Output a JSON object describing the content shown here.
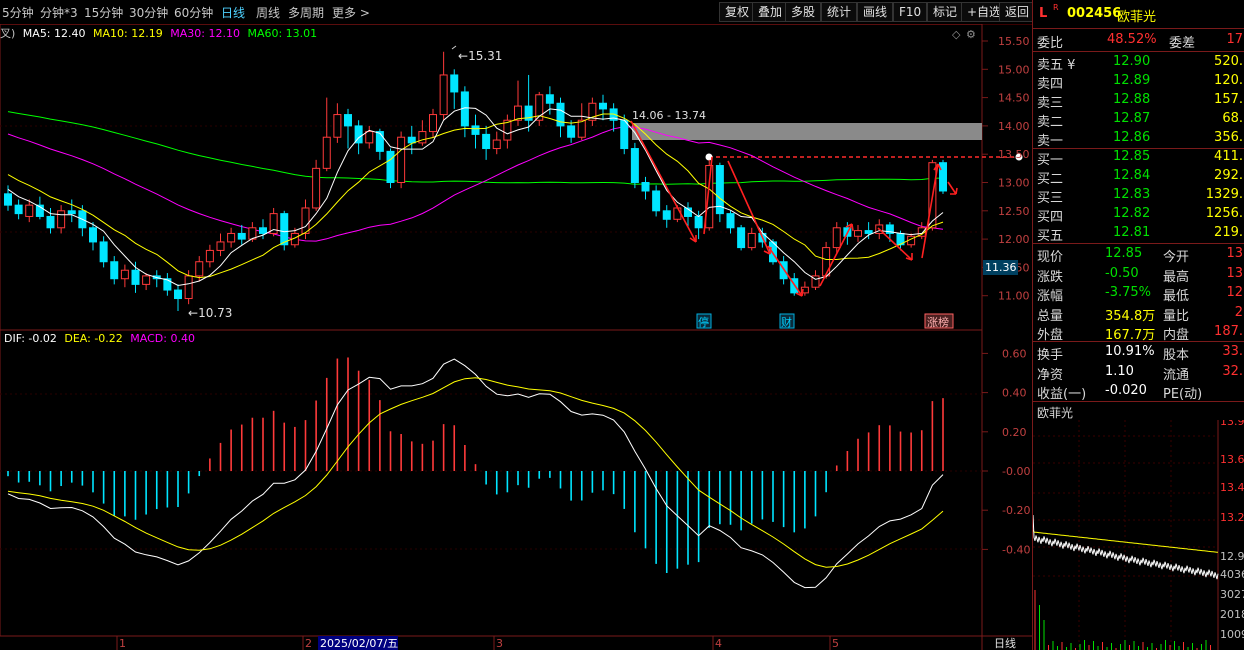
{
  "toolbar": {
    "timeframes": [
      "5分钟",
      "分钟*3",
      "15分钟",
      "30分钟",
      "60分钟",
      "日线",
      "周线",
      "多周期",
      "更多"
    ],
    "active": "日线",
    "buttons": [
      "复权",
      "叠加",
      "多股",
      "统计",
      "画线",
      "F10",
      "标记",
      "+自选",
      "返回"
    ]
  },
  "colors": {
    "up": "#ff3a3a",
    "down": "#00e5ff",
    "ma5": "#ffffff",
    "ma10": "#ffff00",
    "ma30": "#ff00ff",
    "ma60": "#00ff00",
    "accent_red": "#ff2020"
  },
  "ma_legend": {
    "prefix": "叉)",
    "ma5": "MA5: 12.40",
    "ma10": "MA10: 12.19",
    "ma30": "MA30: 12.10",
    "ma60": "MA60: 13.01"
  },
  "price_axis": [
    "15.50",
    "15.00",
    "14.50",
    "14.00",
    "13.50",
    "13.00",
    "12.50",
    "12.00",
    "11.50",
    "11.00"
  ],
  "price_marker": "11.36",
  "annotations": {
    "high": "15.31",
    "low": "10.73",
    "zone": "14.06 - 13.74",
    "badges": [
      "停",
      "财",
      "涨榜"
    ]
  },
  "macd_legend": {
    "dif": "DIF: -0.02",
    "dea": "DEA: -0.22",
    "macd": "MACD: 0.40"
  },
  "macd_axis": [
    "0.60",
    "0.40",
    "0.20",
    "-0.00",
    "-0.20",
    "-0.40"
  ],
  "date_axis": {
    "ticks": [
      "1",
      "2",
      "3",
      "4",
      "5"
    ],
    "highlight": "2025/02/07/五",
    "period": "日线"
  },
  "stock": {
    "flag": "L",
    "code": "002456",
    "name": "欧菲光"
  },
  "quote": {
    "weibi_label": "委比",
    "weibi": "48.52%",
    "weicha_label": "委差",
    "weicha": "17",
    "asks": [
      {
        "label": "卖五",
        "mark": "¥",
        "price": "12.90",
        "vol": "520."
      },
      {
        "label": "卖四",
        "mark": "",
        "price": "12.89",
        "vol": "120."
      },
      {
        "label": "卖三",
        "mark": "",
        "price": "12.88",
        "vol": "157."
      },
      {
        "label": "卖二",
        "mark": "",
        "price": "12.87",
        "vol": "68."
      },
      {
        "label": "卖一",
        "mark": "",
        "price": "12.86",
        "vol": "356."
      }
    ],
    "bids": [
      {
        "label": "买一",
        "price": "12.85",
        "vol": "411."
      },
      {
        "label": "买二",
        "price": "12.84",
        "vol": "292."
      },
      {
        "label": "买三",
        "price": "12.83",
        "vol": "1329."
      },
      {
        "label": "买四",
        "price": "12.82",
        "vol": "1256."
      },
      {
        "label": "买五",
        "price": "12.81",
        "vol": "219."
      }
    ],
    "stats": [
      {
        "l1": "现价",
        "v1": "12.85",
        "l2": "今开",
        "v2": "13"
      },
      {
        "l1": "涨跌",
        "v1": "-0.50",
        "l2": "最高",
        "v2": "13"
      },
      {
        "l1": "涨幅",
        "v1": "-3.75%",
        "l2": "最低",
        "v2": "12"
      },
      {
        "l1": "总量",
        "v1": "354.8万",
        "l2": "量比",
        "v2": "2"
      },
      {
        "l1": "外盘",
        "v1": "167.7万",
        "l2": "内盘",
        "v2": "187."
      }
    ],
    "stats2": [
      {
        "l1": "换手",
        "v1": "10.91%",
        "l2": "股本",
        "v2": "33."
      },
      {
        "l1": "净资",
        "v1": "1.10",
        "l2": "流通",
        "v2": "32."
      },
      {
        "l1": "收益(一)",
        "v1": "-0.020",
        "l2": "PE(动)",
        "v2": ""
      }
    ]
  },
  "mini_chart": {
    "title": "欧菲光",
    "axis": [
      "13.9",
      "13.6",
      "13.4",
      "13.2",
      "12.9"
    ],
    "vol_axis": [
      "4036",
      "3027",
      "2018",
      "1009"
    ]
  }
}
